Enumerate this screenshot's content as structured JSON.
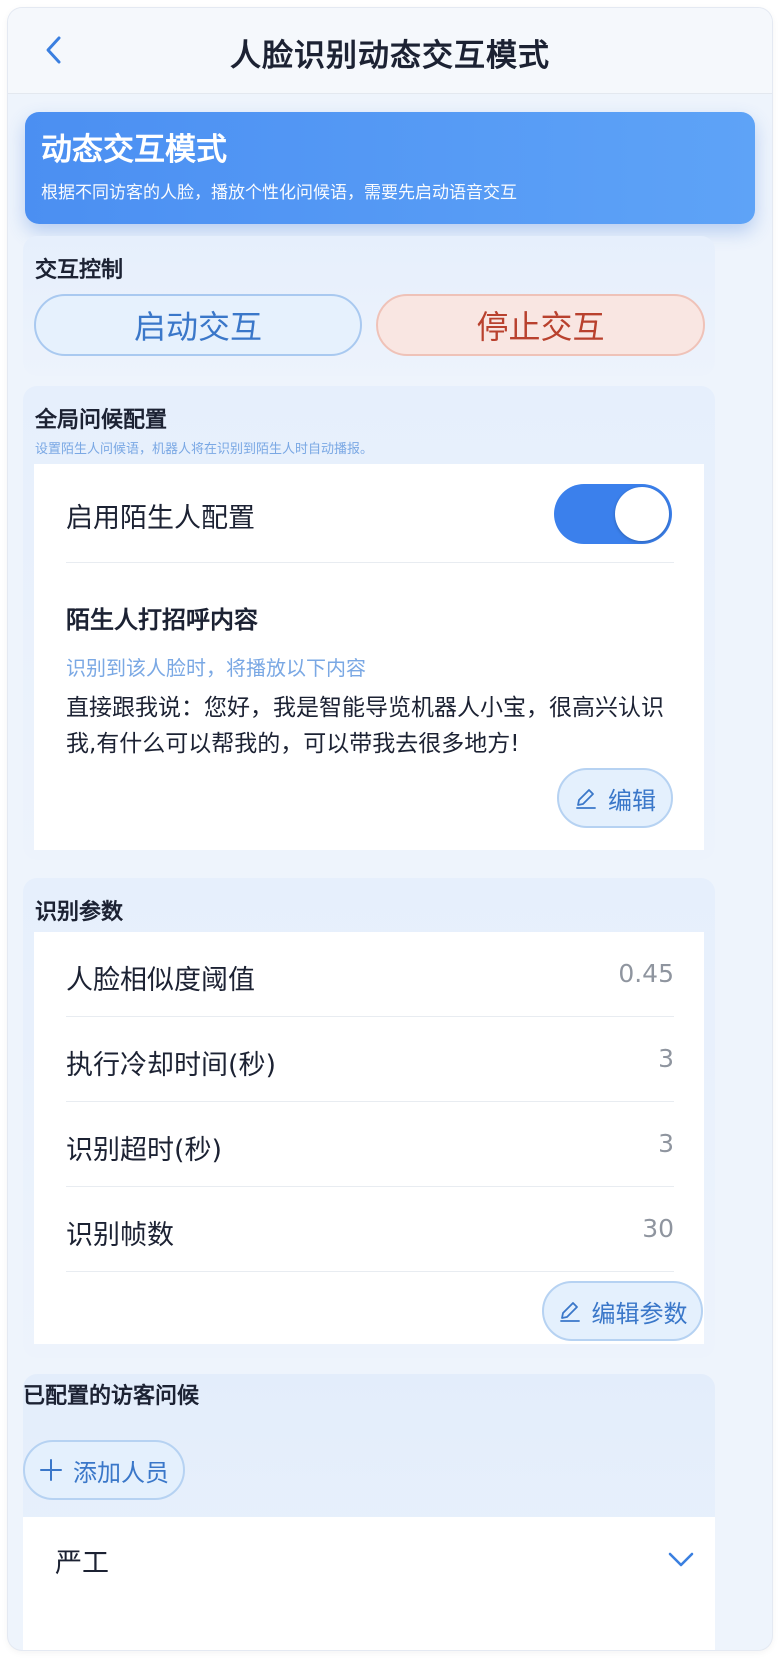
{
  "header": {
    "title": "人脸识别动态交互模式",
    "back_icon": "chevron-left-icon"
  },
  "hero": {
    "title": "动态交互模式",
    "subtitle": "根据不同访客的人脸，播放个性化问候语，需要先启动语音交互"
  },
  "interaction_control": {
    "title": "交互控制",
    "start_label": "启动交互",
    "stop_label": "停止交互"
  },
  "global_greeting": {
    "title": "全局问候配置",
    "description": "设置陌生人问候语，机器人将在识别到陌生人时自动播报。",
    "stranger_toggle_label": "启用陌生人配置",
    "stranger_toggle_on": true,
    "greeting_heading": "陌生人打招呼内容",
    "greeting_hint": "识别到该人脸时，将播放以下内容",
    "greeting_text": "直接跟我说：您好，我是智能导览机器人小宝，很高兴认识我,有什么可以帮我的，可以带我去很多地方!",
    "edit_label": "编辑"
  },
  "recognition_params": {
    "title": "识别参数",
    "rows": [
      {
        "label": "人脸相似度阈值",
        "value": "0.45"
      },
      {
        "label": "执行冷却时间(秒)",
        "value": "3"
      },
      {
        "label": "识别超时(秒)",
        "value": "3"
      },
      {
        "label": "识别帧数",
        "value": "30"
      }
    ],
    "edit_label": "编辑参数"
  },
  "visitors": {
    "title": "已配置的访客问候",
    "add_label": "添加人员",
    "items": [
      {
        "name": "严工"
      }
    ]
  },
  "colors": {
    "accent": "#3b80ec",
    "hero_gradient_start": "#4b8ff2",
    "hero_gradient_end": "#5ea3f7",
    "stop_text": "#b9412e",
    "start_text": "#3a77c9"
  }
}
